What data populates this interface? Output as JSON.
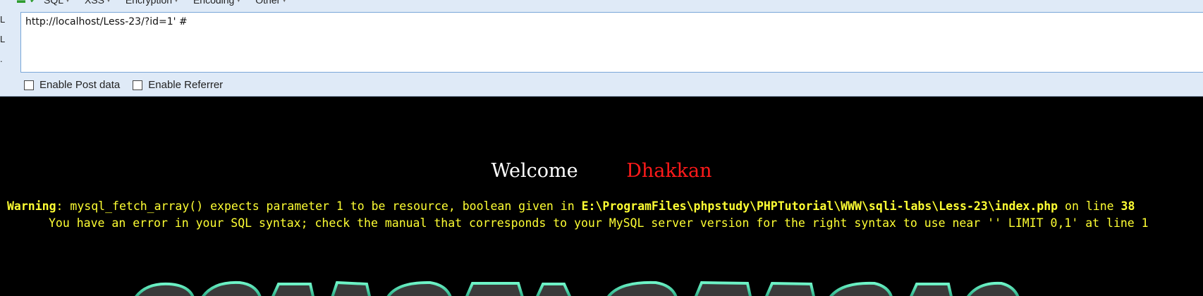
{
  "toolbar": {
    "menu": [
      {
        "label": "SQL"
      },
      {
        "label": "XSS"
      },
      {
        "label": "Encryption"
      },
      {
        "label": "Encoding"
      },
      {
        "label": "Other"
      }
    ],
    "side_labels": [
      "L",
      "L",
      "."
    ],
    "url_value": "http://localhost/Less-23/?id=1' #",
    "options": [
      {
        "label": "Enable Post data",
        "checked": false
      },
      {
        "label": "Enable Referrer",
        "checked": false
      }
    ]
  },
  "page": {
    "welcome_label": "Welcome",
    "user_name": "Dhakkan",
    "warning": {
      "prefix": "Warning",
      "message": ": mysql_fetch_array() expects parameter 1 to be resource, boolean given in ",
      "file": "E:\\ProgramFiles\\phpstudy\\PHPTutorial\\WWW\\sqli-labs\\Less-23\\index.php",
      "line_text": " on line ",
      "line_number": "38"
    },
    "sql_error": "You have an error in your SQL syntax; check the manual that corresponds to your MySQL server version for the right syntax to use near '' LIMIT 0,1' at line 1"
  },
  "colors": {
    "toolbar_bg": "#dfeaf7",
    "page_bg": "#000000",
    "warning_text": "#ffff33",
    "welcome_text": "#ffffff",
    "user_name_text": "#ff1a1a",
    "banner_glow": "#2fd6a4"
  }
}
